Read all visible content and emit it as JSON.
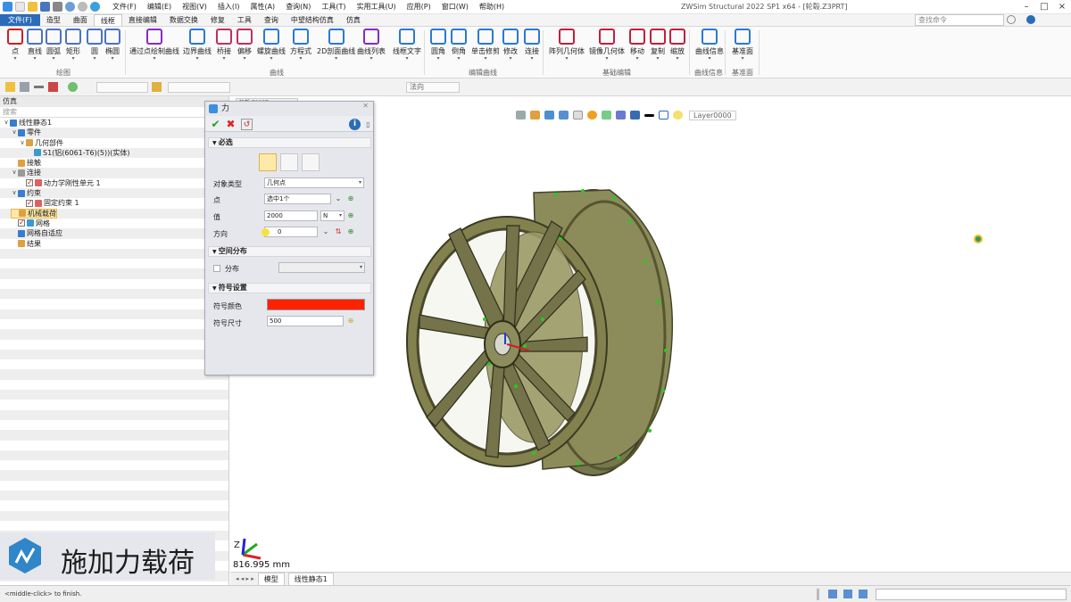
{
  "menu": [
    "文件(F)",
    "编辑(E)",
    "视图(V)",
    "插入(I)",
    "属性(A)",
    "查询(N)",
    "工具(T)",
    "实用工具(U)",
    "应用(P)",
    "窗口(W)",
    "帮助(H)"
  ],
  "app_title": "ZWSim Structural 2022 SP1  x64 - [轮毂.Z3PRT]",
  "search_placeholder": "查找命令",
  "tabs": [
    "文件(F)",
    "造型",
    "曲面",
    "线框",
    "直接编辑",
    "数据交换",
    "修复",
    "工具",
    "查询",
    "中望结构仿真",
    "仿真"
  ],
  "active_tab": "线框",
  "ribbon": {
    "draw": [
      "点",
      "直线",
      "圆弧",
      "矩形",
      "圆",
      "椭圆"
    ],
    "curve": [
      "通过点绘制曲线",
      "边界曲线",
      "桥接",
      "偏移",
      "螺旋曲线",
      "方程式",
      "2D剖面曲线",
      "曲线列表",
      "线框文字"
    ],
    "edit": [
      "圆角",
      "倒角",
      "单击修剪",
      "修改",
      "连接"
    ],
    "basic": [
      "阵列几何体",
      "镜像几何体",
      "移动",
      "复制",
      "缩放"
    ],
    "info": [
      "曲线信息"
    ],
    "plane": [
      "基准面"
    ],
    "groups": [
      "绘图",
      "曲线",
      "编辑曲线",
      "基础编辑",
      "曲线信息",
      "基准面"
    ]
  },
  "toolbar2": {
    "direction_select": "法向"
  },
  "panel": {
    "title": "仿真",
    "search": "搜索",
    "tree": [
      {
        "label": "线性静态1",
        "level": 0,
        "exp": "v"
      },
      {
        "label": "零件",
        "level": 1,
        "exp": "v"
      },
      {
        "label": "几何部件",
        "level": 2,
        "exp": "v"
      },
      {
        "label": "S1(铝(6061-T6)(5))(实体)",
        "level": 3,
        "exp": ""
      },
      {
        "label": "接触",
        "level": 1,
        "exp": ""
      },
      {
        "label": "连接",
        "level": 1,
        "exp": "v"
      },
      {
        "label": "动力学刚性单元 1",
        "level": 2,
        "exp": ""
      },
      {
        "label": "约束",
        "level": 1,
        "exp": "v"
      },
      {
        "label": "固定约束 1",
        "level": 2,
        "exp": ""
      },
      {
        "label": "机械载荷",
        "level": 1,
        "exp": ""
      },
      {
        "label": "网格",
        "level": 1,
        "exp": ""
      },
      {
        "label": "网格自适应",
        "level": 1,
        "exp": ""
      },
      {
        "label": "结果",
        "level": 1,
        "exp": ""
      }
    ]
  },
  "dialog": {
    "title": "力",
    "section_required": "必选",
    "object_type_label": "对象类型",
    "object_type_value": "几何点",
    "point_label": "点",
    "point_value": "选中1个",
    "value_label": "值",
    "value_value": "2000",
    "unit_value": "N",
    "direction_label": "方向",
    "direction_value": "0",
    "section_spatial": "空间分布",
    "distribution_label": "分布",
    "section_symbol": "符号设置",
    "symbol_color_label": "符号颜色",
    "symbol_color": "#ff2200",
    "symbol_size_label": "符号尺寸",
    "symbol_size_value": "500"
  },
  "view": {
    "doc_tab": "轮毂.Z3PRT  ×",
    "layer": "Layer0000",
    "scale": "816.995 mm",
    "axis_z": "Z",
    "bottom_tabs": [
      "模型",
      "线性静态1"
    ]
  },
  "status_text": "<middle-click> to finish.",
  "logo_text": "施加力载荷",
  "colors": {
    "accent": "#2b6cb8",
    "wheel": "#6b6a46",
    "highlight": "#ffe9a8"
  }
}
